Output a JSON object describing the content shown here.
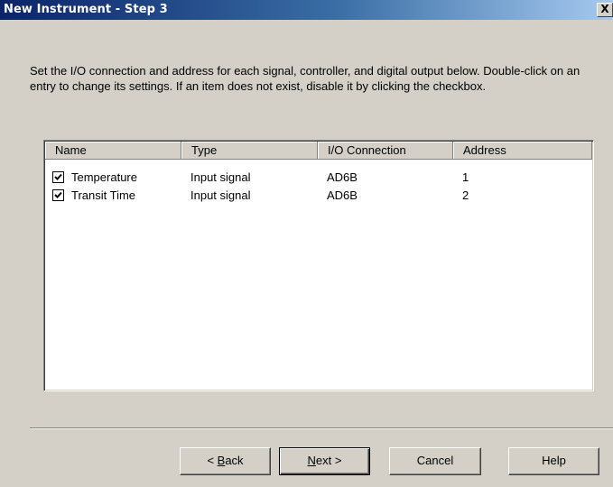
{
  "window": {
    "title": "New Instrument - Step 3",
    "close_label": "X"
  },
  "instructions": "Set the I/O connection and address for each signal, controller, and digital output below. Double-click on an entry to change its settings. If an item does not exist, disable it by clicking the checkbox.",
  "list": {
    "columns": [
      "Name",
      "Type",
      "I/O Connection",
      "Address"
    ],
    "rows": [
      {
        "checked": true,
        "name": "Temperature",
        "type": "Input signal",
        "io": "AD6B",
        "address": "1"
      },
      {
        "checked": true,
        "name": "Transit Time",
        "type": "Input signal",
        "io": "AD6B",
        "address": "2"
      }
    ]
  },
  "buttons": {
    "back": {
      "prefix": "< ",
      "mnemonic": "B",
      "rest": "ack"
    },
    "next": {
      "mnemonic": "N",
      "rest": "ext >"
    },
    "cancel": "Cancel",
    "help": "Help"
  }
}
